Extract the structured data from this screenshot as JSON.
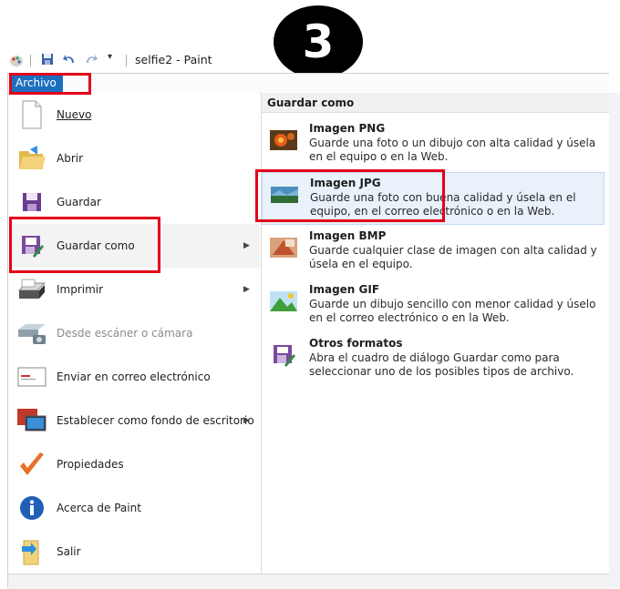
{
  "step_badge": "3",
  "window": {
    "title": "selfie2 - Paint"
  },
  "ribbon": {
    "archivo_tab": "Archivo"
  },
  "menu": {
    "items": [
      {
        "label": "Nuevo",
        "icon": "new-document-icon"
      },
      {
        "label": "Abrir",
        "icon": "open-folder-icon"
      },
      {
        "label": "Guardar",
        "icon": "save-disk-icon"
      },
      {
        "label": "Guardar como",
        "icon": "save-as-icon",
        "submenu": true
      },
      {
        "label": "Imprimir",
        "icon": "printer-icon",
        "submenu": true
      },
      {
        "label": "Desde escáner o cámara",
        "icon": "scanner-icon",
        "disabled": true
      },
      {
        "label": "Enviar en correo electrónico",
        "icon": "email-icon"
      },
      {
        "label": "Establecer como fondo de escritorio",
        "icon": "desktop-background-icon",
        "submenu": true
      },
      {
        "label": "Propiedades",
        "icon": "checkmark-icon"
      },
      {
        "label": "Acerca de Paint",
        "icon": "info-icon"
      },
      {
        "label": "Salir",
        "icon": "exit-icon"
      }
    ]
  },
  "submenu": {
    "header": "Guardar como",
    "options": [
      {
        "title": "Imagen PNG",
        "description": "Guarde una foto o un dibujo con alta calidad y úsela en el equipo o en la Web.",
        "icon": "png-image-icon"
      },
      {
        "title": "Imagen JPG",
        "description": "Guarde una foto con buena calidad y úsela en el equipo, en el correo electrónico o en la Web.",
        "icon": "jpg-image-icon",
        "active": true
      },
      {
        "title": "Imagen BMP",
        "description": "Guarde cualquier clase de imagen con alta calidad y úsela en el equipo.",
        "icon": "bmp-image-icon"
      },
      {
        "title": "Imagen GIF",
        "description": "Guarde un dibujo sencillo con menor calidad y úselo en el correo electrónico o en la Web.",
        "icon": "gif-image-icon"
      },
      {
        "title": "Otros formatos",
        "description": "Abra el cuadro de diálogo Guardar como para seleccionar uno de los posibles tipos de archivo.",
        "icon": "other-formats-icon"
      }
    ]
  },
  "colors": {
    "accent": "#1c6fbf",
    "highlight_box": "#e3001b",
    "active_option_bg": "#e9f1fb"
  }
}
